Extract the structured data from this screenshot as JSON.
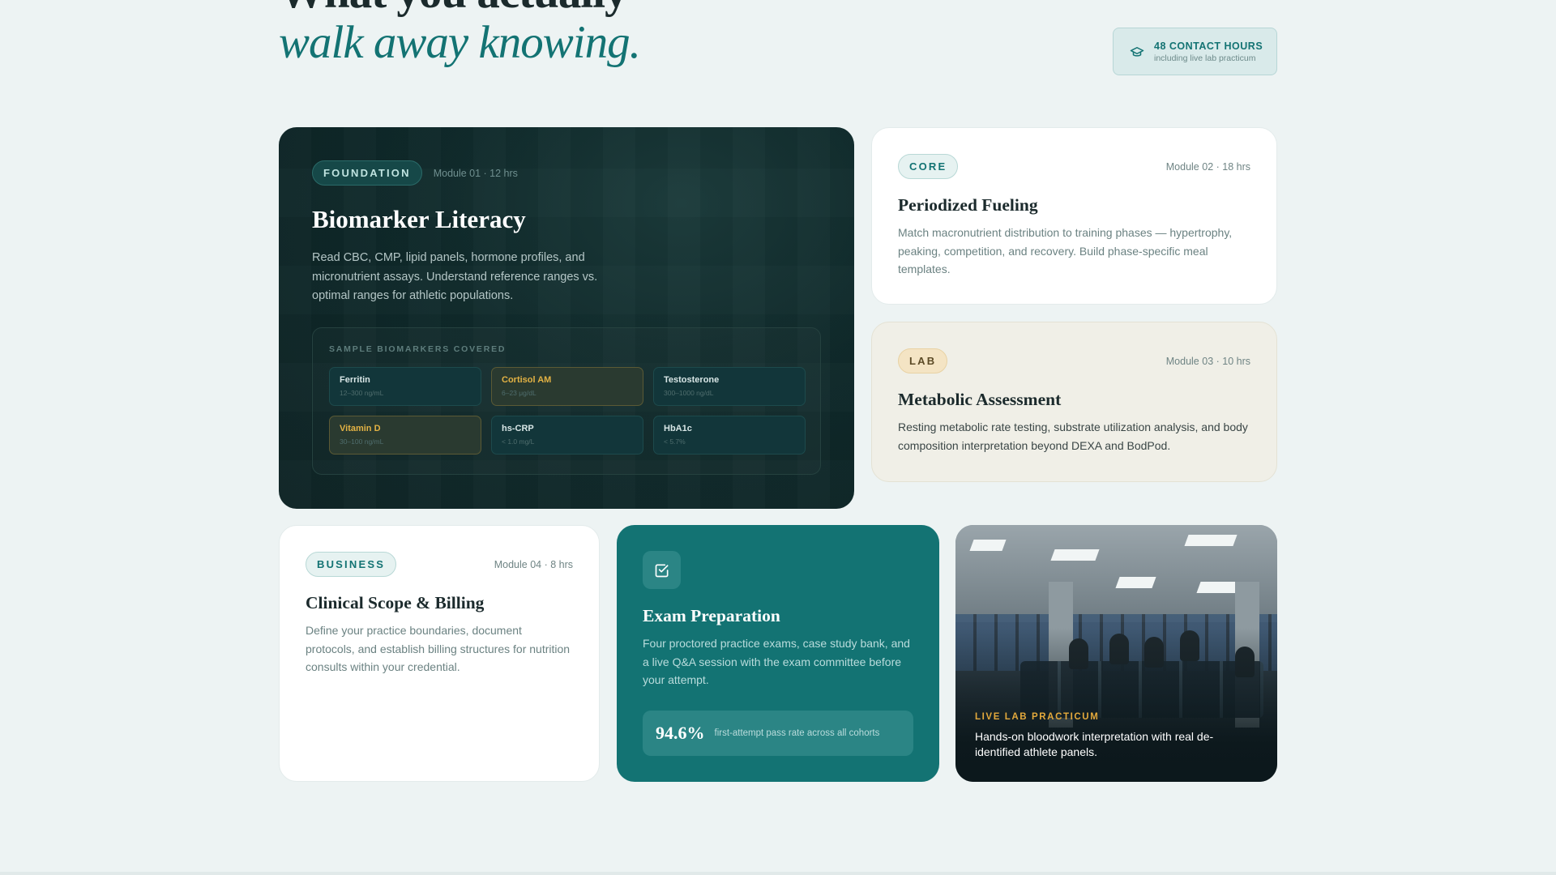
{
  "heading": {
    "line1": "What you actually",
    "line2": "walk away knowing."
  },
  "hours_pill": {
    "icon": "graduation-cap-icon",
    "title": "48 CONTACT HOURS",
    "subtitle": "including live lab practicum"
  },
  "modules": {
    "foundation": {
      "badge": "FOUNDATION",
      "meta": "Module 01 · 12 hrs",
      "title": "Biomarker Literacy",
      "description": "Read CBC, CMP, lipid panels, hormone profiles, and micronutrient assays. Understand reference ranges vs. optimal ranges for athletic populations.",
      "panel_title": "SAMPLE BIOMARKERS COVERED",
      "biomarkers": [
        {
          "name": "Ferritin",
          "range": "12–300 ng/mL",
          "highlight": false
        },
        {
          "name": "Cortisol AM",
          "range": "6–23 μg/dL",
          "highlight": true
        },
        {
          "name": "Testosterone",
          "range": "300–1000 ng/dL",
          "highlight": false
        },
        {
          "name": "Vitamin D",
          "range": "30–100 ng/mL",
          "highlight": true
        },
        {
          "name": "hs-CRP",
          "range": "< 1.0 mg/L",
          "highlight": false
        },
        {
          "name": "HbA1c",
          "range": "< 5.7%",
          "highlight": false
        }
      ]
    },
    "core": {
      "badge": "CORE",
      "meta": "Module 02 · 18 hrs",
      "title": "Periodized Fueling",
      "description": "Match macronutrient distribution to training phases — hypertrophy, peaking, competition, and recovery. Build phase-specific meal templates."
    },
    "lab": {
      "badge": "LAB",
      "meta": "Module 03 · 10 hrs",
      "title": "Metabolic Assessment",
      "description": "Resting metabolic rate testing, substrate utilization analysis, and body composition interpretation beyond DEXA and BodPod."
    },
    "business": {
      "badge": "BUSINESS",
      "meta": "Module 04 · 8 hrs",
      "title": "Clinical Scope & Billing",
      "description": "Define your practice boundaries, document protocols, and establish billing structures for nutrition consults within your credential."
    },
    "exam": {
      "icon": "checkbox-icon",
      "title": "Exam Preparation",
      "description": "Four proctored practice exams, case study bank, and a live Q&A session with the exam committee before your attempt.",
      "stat_value": "94.6%",
      "stat_label": "first-attempt pass rate across all cohorts"
    },
    "photo": {
      "kicker": "LIVE LAB PRACTICUM",
      "caption": "Hands-on bloodwork interpretation with real de-identified athlete panels."
    }
  },
  "colors": {
    "accent": "#137373",
    "dark": "#0f2a2b",
    "warning": "#e3b244",
    "background": "#edf3f3"
  }
}
